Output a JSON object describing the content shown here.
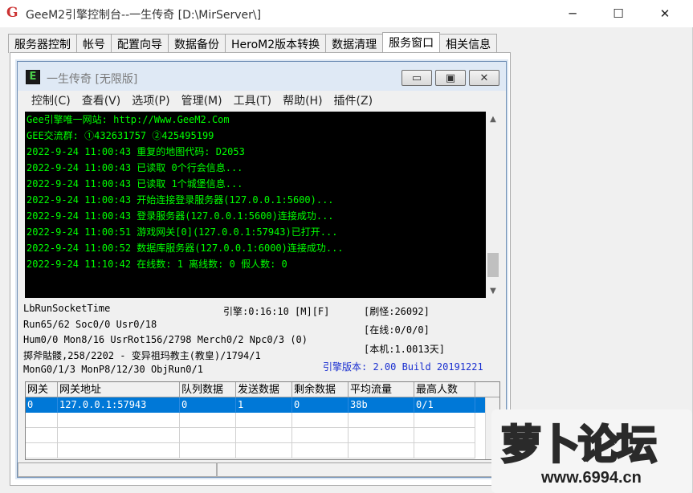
{
  "window": {
    "title": "GeeM2引擎控制台--一生传奇 [D:\\MirServer\\]",
    "app_icon": "G",
    "controls": [
      "─",
      "☐",
      "✕"
    ]
  },
  "tabs": [
    {
      "label": "服务器控制",
      "active": false
    },
    {
      "label": "帐号",
      "active": false
    },
    {
      "label": "配置向导",
      "active": false
    },
    {
      "label": "数据备份",
      "active": false
    },
    {
      "label": "HeroM2版本转换",
      "active": false
    },
    {
      "label": "数据清理",
      "active": false
    },
    {
      "label": "服务窗口",
      "active": true
    },
    {
      "label": "相关信息",
      "active": false
    }
  ],
  "inner_window": {
    "icon_letter": "E",
    "title": "一生传奇 [无限版]",
    "buttons": [
      "▭",
      "▣",
      "✕"
    ],
    "menu": [
      "控制(C)",
      "查看(V)",
      "选项(P)",
      "管理(M)",
      "工具(T)",
      "帮助(H)",
      "插件(Z)"
    ]
  },
  "log_lines": [
    "Gee引擎唯一网站: http://Www.GeeM2.Com",
    "GEE交流群: ①432631757   ②425495199",
    "2022-9-24 11:00:43 重复的地图代码: D2053",
    "2022-9-24 11:00:43 已读取 0个行会信息...",
    "2022-9-24 11:00:43 已读取 1个城堡信息...",
    "2022-9-24 11:00:43 开始连接登录服务器(127.0.0.1:5600)...",
    "2022-9-24 11:00:43 登录服务器(127.0.0.1:5600)连接成功...",
    "2022-9-24 11:00:51 游戏网关[0](127.0.0.1:57943)已打开...",
    "2022-9-24 11:00:52 数据库服务器(127.0.0.1:6000)连接成功...",
    "2022-9-24 11:10:42 在线数: 1 离线数: 0 假人数: 0"
  ],
  "status": {
    "lb_run": "LbRunSocketTime",
    "run": "Run65/62 Soc0/0 Usr0/18",
    "hum": "Hum0/0 Mon8/16 UsrRot156/2798 Merch0/2 Npc0/3 (0)",
    "boss": "掷斧骷髅,258/2202 - 变异祖玛教主(教皇)/1794/1",
    "mon": "MonG0/1/3 MonP8/12/30 ObjRun0/1",
    "engine_time": "引擎:0:16:10 [M][F]",
    "refresh": "[刷怪:26092]",
    "online": "[在线:0/0/0]",
    "local": "[本机:1.0013天]",
    "version": "引擎版本: 2.00 Build 20191221"
  },
  "gate_table": {
    "columns": [
      "网关",
      "网关地址",
      "队列数据",
      "发送数据",
      "剩余数据",
      "平均流量",
      "最高人数"
    ],
    "rows": [
      [
        "0",
        "127.0.0.1:57943",
        "0",
        "1",
        "0",
        "38b",
        "0/1"
      ]
    ]
  },
  "watermark": {
    "logo": "萝卜论坛",
    "url": "www.6994.cn"
  }
}
